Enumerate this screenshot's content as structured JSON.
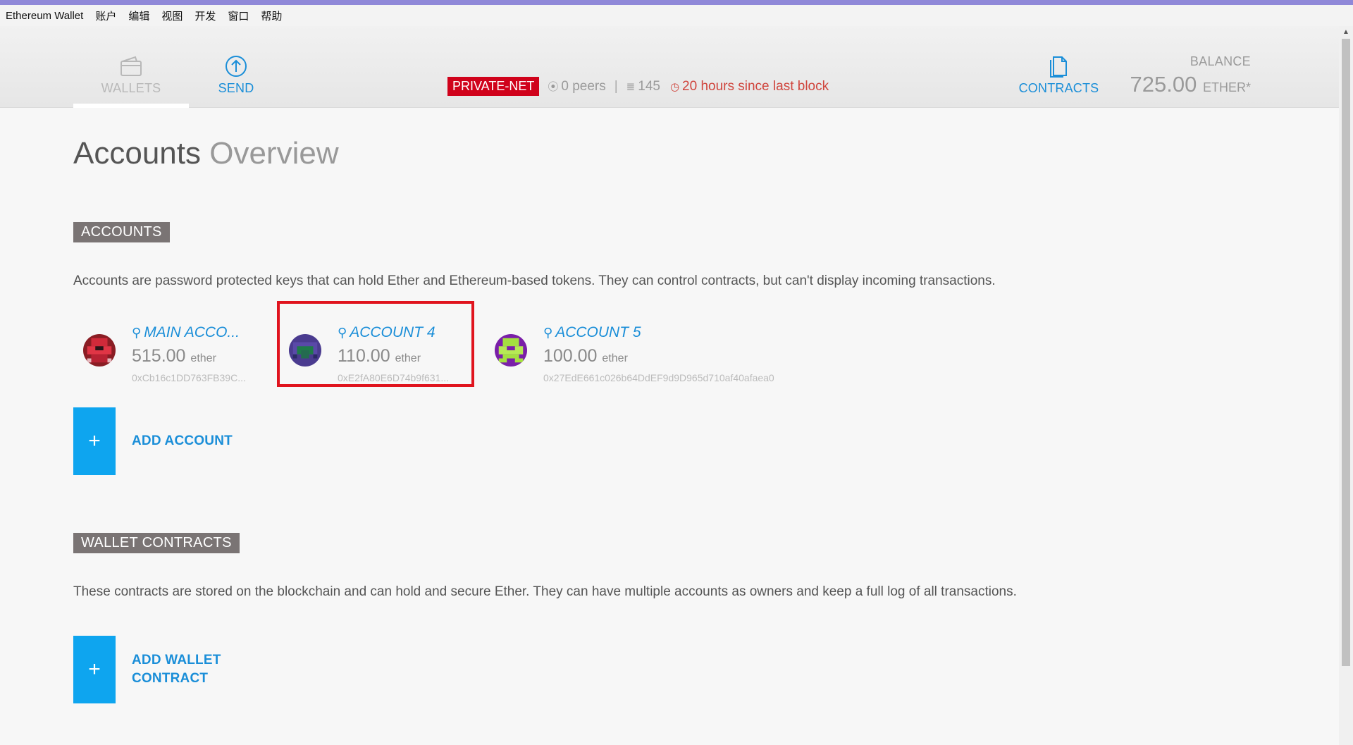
{
  "window": {
    "app_title": "Ethereum Wallet",
    "menu": [
      "账户",
      "编辑",
      "视图",
      "开发",
      "窗口",
      "帮助"
    ]
  },
  "nav": {
    "wallets_label": "WALLETS",
    "send_label": "SEND",
    "contracts_label": "CONTRACTS",
    "active": "WALLETS"
  },
  "status": {
    "network": "PRIVATE-NET",
    "peers": "0 peers",
    "separator": "|",
    "block": "145",
    "last_block": "20 hours since last block"
  },
  "balance": {
    "label": "BALANCE",
    "value": "725.00",
    "unit": "ETHER*"
  },
  "page": {
    "title_strong": "Accounts",
    "title_light": "Overview"
  },
  "accounts_section": {
    "label": "ACCOUNTS",
    "description": "Accounts are password protected keys that can hold Ether and Ethereum-based tokens. They can control contracts, but can't display incoming transactions.",
    "items": [
      {
        "name": "MAIN ACCO...",
        "amount": "515.00",
        "unit": "ether",
        "address": "0xCb16c1DD763FB39C...",
        "highlighted": false
      },
      {
        "name": "ACCOUNT 4",
        "amount": "110.00",
        "unit": "ether",
        "address": "0xE2fA80E6D74b9f631...",
        "highlighted": true
      },
      {
        "name": "ACCOUNT 5",
        "amount": "100.00",
        "unit": "ether",
        "address": "0x27EdE661c026b64DdEF9d9D965d710af40afaea0",
        "highlighted": false
      }
    ],
    "add_label": "ADD ACCOUNT",
    "add_symbol": "+"
  },
  "wallet_contracts_section": {
    "label": "WALLET CONTRACTS",
    "description": "These contracts are stored on the blockchain and can hold and secure Ether. They can have multiple accounts as owners and keep a full log of all transactions.",
    "add_label_line1": "ADD WALLET",
    "add_label_line2": "CONTRACT",
    "add_symbol": "+"
  },
  "colors": {
    "accent_blue": "#1a8ed8",
    "tile_blue": "#0ea5ef",
    "network_red": "#d0021b",
    "highlight_red": "#e0141e",
    "section_label_bg": "#7a7474"
  },
  "icons": {
    "wallets": "wallet-icon",
    "send": "arrow-up-circle-icon",
    "contracts": "document-icon",
    "peers": "signal-icon",
    "block": "layers-icon",
    "last_block": "clock-icon",
    "account_key": "key-icon"
  }
}
